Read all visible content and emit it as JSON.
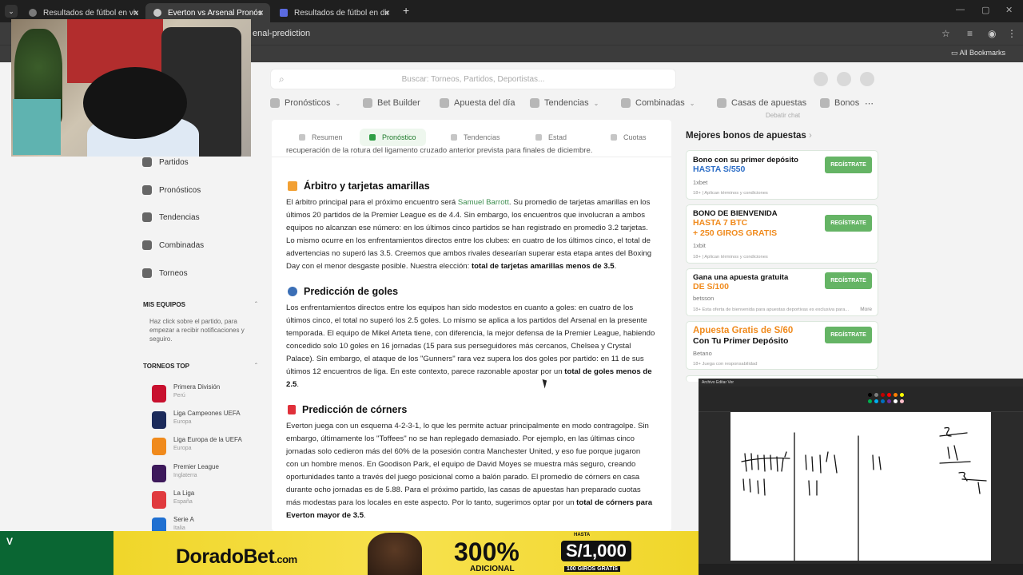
{
  "browser": {
    "tabs": [
      {
        "title": "Resultados de fútbol en vivo, M"
      },
      {
        "title": "Everton vs Arsenal Pronósticos"
      },
      {
        "title": "Resultados de fútbol en directo"
      }
    ],
    "address_fragment": "enal-prediction",
    "bookmarks_label": "All Bookmarks"
  },
  "site": {
    "search_placeholder": "Buscar: Torneos, Partidos, Deportistas...",
    "nav": [
      {
        "label": "Pronósticos",
        "dropdown": true
      },
      {
        "label": "Bet Builder",
        "dropdown": false
      },
      {
        "label": "Apuesta del día",
        "dropdown": false
      },
      {
        "label": "Tendencias",
        "dropdown": true
      },
      {
        "label": "Combinadas",
        "dropdown": true
      },
      {
        "label": "Casas de apuestas",
        "dropdown": false
      },
      {
        "label": "Bonos",
        "dropdown": false
      }
    ]
  },
  "sidebar": {
    "items": [
      "Partidos",
      "Pronósticos",
      "Tendencias",
      "Combinadas",
      "Torneos"
    ],
    "my_teams_heading": "MIS EQUIPOS",
    "my_teams_note": "Haz click   sobre el partido, para empezar a recibir notificaciones y seguiro.",
    "top_tournaments_heading": "TORNEOS TOP",
    "leagues": [
      {
        "name": "Primera División",
        "country": "Perú",
        "color": "#c8102e"
      },
      {
        "name": "Liga Campeones UEFA",
        "country": "Europa",
        "color": "#1b2a5a"
      },
      {
        "name": "Liga Europa de la UEFA",
        "country": "Europa",
        "color": "#f08a1c"
      },
      {
        "name": "Premier League",
        "country": "Inglaterra",
        "color": "#3d195b"
      },
      {
        "name": "La Liga",
        "country": "España",
        "color": "#e03a3e"
      },
      {
        "name": "Serie A",
        "country": "Italia",
        "color": "#1f6fd1"
      }
    ]
  },
  "article": {
    "subtabs": [
      {
        "label": "Resumen",
        "active": false
      },
      {
        "label": "Pronóstico",
        "active": true
      },
      {
        "label": "Tendencias",
        "active": false
      },
      {
        "label": "Estad",
        "active": false
      },
      {
        "label": "Cuotas",
        "active": false
      }
    ],
    "prev_line": "recuperación de la rotura del ligamento cruzado anterior prevista para finales de diciembre.",
    "sections": [
      {
        "title": "Árbitro y tarjetas amarillas",
        "icon_color": "#f2a033",
        "lines": [
          [
            "El árbitro principal para el próximo encuentro será ",
            {
              "link": "Samuel Barrott"
            },
            ". Su promedio de tarjetas amarillas en los"
          ],
          [
            "últimos 20 partidos de la Premier League es de 4.4. Sin embargo, los encuentros que involucran a ambos"
          ],
          [
            "equipos no alcanzan ese número: en los últimos cinco partidos se han registrado en promedio 3.2 tarjetas."
          ],
          [
            "Lo mismo ocurre en los enfrentamientos directos entre los clubes: en cuatro de los últimos cinco, el total de"
          ],
          [
            "advertencias no superó las 3.5. Creemos que ambos rivales desearían superar esta etapa antes del Boxing"
          ],
          [
            "Day con el menor desgaste posible. Nuestra elección: ",
            {
              "bold": "total de tarjetas amarillas menos de 3.5"
            },
            "."
          ]
        ]
      },
      {
        "title": "Predicción de goles",
        "icon_color": "#3b6fb6",
        "lines": [
          [
            "Los enfrentamientos directos entre los equipos han sido modestos en cuanto a goles: en cuatro de los"
          ],
          [
            "últimos cinco, el total no superó los 2.5 goles. Lo mismo se aplica a los partidos del Arsenal en la presente"
          ],
          [
            "temporada. El equipo de Mikel Arteta tiene, con diferencia, la mejor defensa de la Premier League, habiendo"
          ],
          [
            "concedido solo 10 goles en 16 jornadas (15 para sus perseguidores más cercanos, Chelsea y Crystal"
          ],
          [
            "Palace). Sin embargo, el ataque de los \"Gunners\" rara vez supera los dos goles por partido: en 11 de sus"
          ],
          [
            "últimos 12 encuentros de liga. En este contexto, parece razonable apostar por un ",
            {
              "bold": "total de goles menos de"
            }
          ],
          [
            {
              "bold": "2.5"
            },
            "."
          ]
        ]
      },
      {
        "title": "Predicción de córners",
        "icon_color": "#e0303a",
        "lines": [
          [
            "Everton juega con un esquema 4-2-3-1, lo que les permite actuar principalmente en modo contragolpe. Sin"
          ],
          [
            "embargo, últimamente los \"Toffees\" no se han replegado demasiado. Por ejemplo, en las últimas cinco"
          ],
          [
            "jornadas solo cedieron más del 60% de la posesión contra Manchester United, y eso fue porque jugaron"
          ],
          [
            "con un hombre menos. En Goodison Park, el equipo de David Moyes se muestra más seguro, creando"
          ],
          [
            "oportunidades tanto a través del juego posicional como a balón parado. El promedio de córners en casa"
          ],
          [
            "durante ocho jornadas es de 5.88. Para el próximo partido, las casas de apuestas han preparado cuotas"
          ],
          [
            "más modestas para los locales en este aspecto. Por lo tanto, sugerimos optar por un ",
            {
              "bold": "total de córners para"
            }
          ],
          [
            {
              "bold": "Everton mayor de 3.5"
            },
            "."
          ]
        ]
      }
    ]
  },
  "bonuses": {
    "prev_text": "Debatir chat",
    "title": "Mejores bonos de apuestas",
    "cta": "REGÍSTRATE",
    "cards": [
      {
        "line1": "Bono con su primer depósito",
        "line2": "HASTA S/550",
        "line3": "",
        "bookmaker": "1xbet",
        "terms": "18+ | Aplican términos y condiciones",
        "more": ""
      },
      {
        "line1": "BONO DE BIENVENIDA",
        "line2": "HASTA 7 BTC",
        "line3": "+ 250 GIROS GRATIS",
        "bookmaker": "1xbit",
        "terms": "18+ | Aplican términos y condiciones",
        "more": ""
      },
      {
        "line1": "Gana una apuesta gratuita",
        "line2": "DE S/100",
        "line3": "",
        "bookmaker": "betsson",
        "terms": "18+ Esta oferta de bienvenida para apuestas deportivas es exclusiva para...",
        "more": "More"
      },
      {
        "line1": "Apuesta Gratis de S/60",
        "line2": "Con Tu Primer Depósito",
        "line3": "",
        "bookmaker": "Betano",
        "terms": "18+ Juega con responsabilidad",
        "more": ""
      }
    ]
  },
  "ad": {
    "brand": "DoradoBet",
    "brand_suffix": ".com",
    "percent": "300%",
    "percent_sub": "ADICIONAL",
    "amount": "S/1,000",
    "amount_top": "HASTA",
    "amount_sub": "100 GIROS GRATIS",
    "first_deposit": "PRIMER DEPÓSITO"
  },
  "paint": {
    "menu": "Archivo   Editar   Ver",
    "colors": [
      "#000000",
      "#7f7f7f",
      "#c00000",
      "#ff0000",
      "#ff8000",
      "#ffff00",
      "#00b050",
      "#00b0f0",
      "#0070c0",
      "#7030a0",
      "#ffffff",
      "#ffc0cb"
    ]
  }
}
